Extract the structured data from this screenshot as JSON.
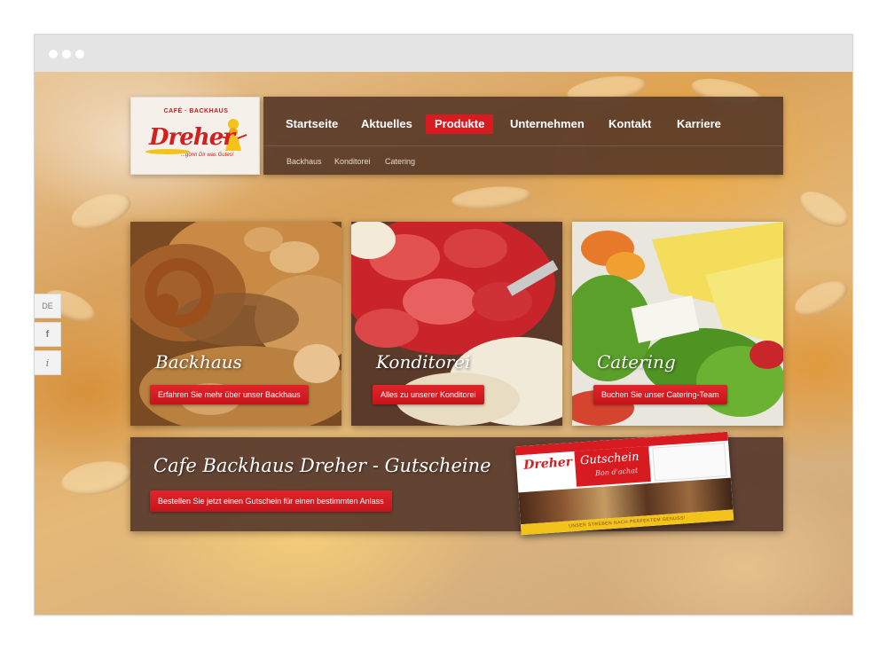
{
  "logo": {
    "top_line": "CAFÉ · BACKHAUS",
    "brand": "Dreher",
    "tagline": "...gönn Dir was Gutes!"
  },
  "nav": {
    "items": [
      {
        "label": "Startseite",
        "active": false
      },
      {
        "label": "Aktuelles",
        "active": false
      },
      {
        "label": "Produkte",
        "active": true
      },
      {
        "label": "Unternehmen",
        "active": false
      },
      {
        "label": "Kontakt",
        "active": false
      },
      {
        "label": "Karriere",
        "active": false
      }
    ],
    "sub_items": [
      "Backhaus",
      "Konditorei",
      "Catering"
    ]
  },
  "side_tabs": {
    "language": "DE",
    "facebook": "f",
    "info": "i"
  },
  "cards": [
    {
      "title": "Backhaus",
      "button": "Erfahren Sie mehr über unser Backhaus"
    },
    {
      "title": "Konditorei",
      "button": "Alles zu unserer Konditorei"
    },
    {
      "title": "Catering",
      "button": "Buchen Sie unser Catering-Team"
    }
  ],
  "banner": {
    "title": "Cafe Backhaus Dreher - Gutscheine",
    "button": "Bestellen Sie jetzt einen Gutschein für einen bestimmten Anlass",
    "voucher": {
      "brand": "Dreher",
      "title": "Gutschein",
      "subtitle": "Bon d'achat",
      "footer": "UNSER STREBEN NACH PERFEKTEM GENUSS!"
    }
  },
  "colors": {
    "accent_red": "#d81b21",
    "nav_brown": "#523426",
    "logo_yellow": "#f3c21b"
  }
}
